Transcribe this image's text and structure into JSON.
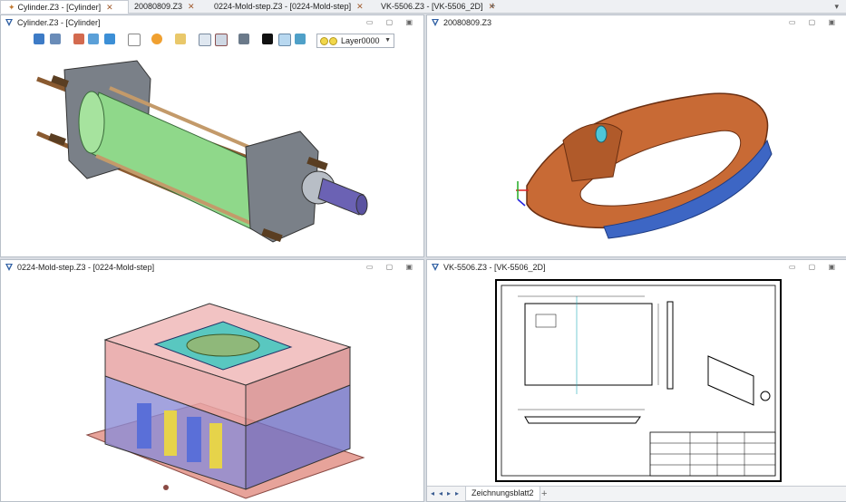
{
  "tabs": [
    {
      "label": "Cylinder.Z3 - [Cylinder]",
      "active": true
    },
    {
      "label": "20080809.Z3",
      "active": false
    },
    {
      "label": "0224-Mold-step.Z3 - [0224-Mold-step]",
      "active": false
    },
    {
      "label": "VK-5506.Z3 - [VK-5506_2D]",
      "active": false
    }
  ],
  "tab_add": "+",
  "tab_menu": "▾",
  "panes": {
    "cylinder": {
      "title": "Cylinder.Z3 - [Cylinder]",
      "layer": "Layer0000"
    },
    "part": {
      "title": "20080809.Z3"
    },
    "mold": {
      "title": "0224-Mold-step.Z3 - [0224-Mold-step]"
    },
    "drawing": {
      "title": "VK-5506.Z3 - [VK-5506_2D]",
      "sheet_tab": "Zeichnungsblatt2",
      "sheet_add": "+"
    }
  },
  "pane_controls": "▭ ▢ ▣",
  "nav": {
    "first": "◂",
    "prev": "◂",
    "next": "▸",
    "last": "▸"
  }
}
